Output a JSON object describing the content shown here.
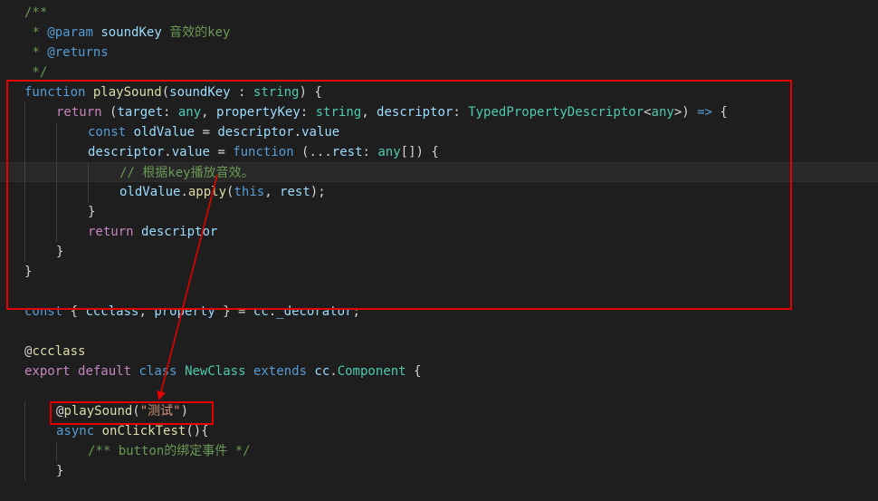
{
  "colors": {
    "background": "#1e1e1e",
    "comment": "#6a9955",
    "keyword": "#569cd6",
    "control": "#c586c0",
    "function": "#dcdcaa",
    "variable": "#9cdcfe",
    "type": "#4ec9b0",
    "string": "#ce9178",
    "plain": "#d4d4d4",
    "annotation": "#e50000"
  },
  "code_lines": [
    {
      "indent": 1,
      "tokens": [
        {
          "t": "/**",
          "c": "comment"
        }
      ]
    },
    {
      "indent": 1,
      "tokens": [
        {
          "t": " * ",
          "c": "comment"
        },
        {
          "t": "@param",
          "c": "keyword"
        },
        {
          "t": " ",
          "c": "comment"
        },
        {
          "t": "soundKey",
          "c": "variable"
        },
        {
          "t": " 音效的key",
          "c": "comment"
        }
      ]
    },
    {
      "indent": 1,
      "tokens": [
        {
          "t": " * ",
          "c": "comment"
        },
        {
          "t": "@returns",
          "c": "keyword"
        }
      ]
    },
    {
      "indent": 1,
      "tokens": [
        {
          "t": " */",
          "c": "comment"
        }
      ]
    },
    {
      "indent": 1,
      "tokens": [
        {
          "t": "function",
          "c": "keyword"
        },
        {
          "t": " ",
          "c": "plain"
        },
        {
          "t": "playSound",
          "c": "function"
        },
        {
          "t": "(",
          "c": "plain"
        },
        {
          "t": "soundKey",
          "c": "variable"
        },
        {
          "t": " : ",
          "c": "plain"
        },
        {
          "t": "string",
          "c": "type"
        },
        {
          "t": ") {",
          "c": "plain"
        }
      ]
    },
    {
      "indent": 2,
      "tokens": [
        {
          "t": "return",
          "c": "control"
        },
        {
          "t": " (",
          "c": "plain"
        },
        {
          "t": "target",
          "c": "variable"
        },
        {
          "t": ": ",
          "c": "plain"
        },
        {
          "t": "any",
          "c": "type"
        },
        {
          "t": ", ",
          "c": "plain"
        },
        {
          "t": "propertyKey",
          "c": "variable"
        },
        {
          "t": ": ",
          "c": "plain"
        },
        {
          "t": "string",
          "c": "type"
        },
        {
          "t": ", ",
          "c": "plain"
        },
        {
          "t": "descriptor",
          "c": "variable"
        },
        {
          "t": ": ",
          "c": "plain"
        },
        {
          "t": "TypedPropertyDescriptor",
          "c": "type"
        },
        {
          "t": "<",
          "c": "plain"
        },
        {
          "t": "any",
          "c": "type"
        },
        {
          "t": ">) ",
          "c": "plain"
        },
        {
          "t": "=>",
          "c": "keyword"
        },
        {
          "t": " {",
          "c": "plain"
        }
      ]
    },
    {
      "indent": 3,
      "tokens": [
        {
          "t": "const",
          "c": "keyword"
        },
        {
          "t": " ",
          "c": "plain"
        },
        {
          "t": "oldValue",
          "c": "variable"
        },
        {
          "t": " = ",
          "c": "plain"
        },
        {
          "t": "descriptor",
          "c": "variable"
        },
        {
          "t": ".",
          "c": "plain"
        },
        {
          "t": "value",
          "c": "variable"
        }
      ]
    },
    {
      "indent": 3,
      "tokens": [
        {
          "t": "descriptor",
          "c": "variable"
        },
        {
          "t": ".",
          "c": "plain"
        },
        {
          "t": "value",
          "c": "variable"
        },
        {
          "t": " = ",
          "c": "plain"
        },
        {
          "t": "function",
          "c": "keyword"
        },
        {
          "t": " (...",
          "c": "plain"
        },
        {
          "t": "rest",
          "c": "variable"
        },
        {
          "t": ": ",
          "c": "plain"
        },
        {
          "t": "any",
          "c": "type"
        },
        {
          "t": "[]) {",
          "c": "plain"
        }
      ]
    },
    {
      "indent": 4,
      "current": true,
      "tokens": [
        {
          "t": "// 根据key播放音效。",
          "c": "comment"
        }
      ]
    },
    {
      "indent": 4,
      "tokens": [
        {
          "t": "oldValue",
          "c": "variable"
        },
        {
          "t": ".",
          "c": "plain"
        },
        {
          "t": "apply",
          "c": "function"
        },
        {
          "t": "(",
          "c": "plain"
        },
        {
          "t": "this",
          "c": "keyword"
        },
        {
          "t": ", ",
          "c": "plain"
        },
        {
          "t": "rest",
          "c": "variable"
        },
        {
          "t": ");",
          "c": "plain"
        }
      ]
    },
    {
      "indent": 3,
      "tokens": [
        {
          "t": "}",
          "c": "plain"
        }
      ]
    },
    {
      "indent": 3,
      "tokens": [
        {
          "t": "return",
          "c": "control"
        },
        {
          "t": " ",
          "c": "plain"
        },
        {
          "t": "descriptor",
          "c": "variable"
        }
      ]
    },
    {
      "indent": 2,
      "tokens": [
        {
          "t": "}",
          "c": "plain"
        }
      ]
    },
    {
      "indent": 1,
      "tokens": [
        {
          "t": "}",
          "c": "plain"
        }
      ]
    },
    {
      "indent": 1,
      "tokens": []
    },
    {
      "indent": 1,
      "tokens": [
        {
          "t": "const",
          "c": "keyword"
        },
        {
          "t": " { ",
          "c": "plain"
        },
        {
          "t": "ccclass",
          "c": "variable"
        },
        {
          "t": ", ",
          "c": "plain"
        },
        {
          "t": "property",
          "c": "variable"
        },
        {
          "t": " } = ",
          "c": "plain"
        },
        {
          "t": "cc",
          "c": "variable"
        },
        {
          "t": ".",
          "c": "plain"
        },
        {
          "t": "_decorator",
          "c": "variable"
        },
        {
          "t": ";",
          "c": "plain"
        }
      ]
    },
    {
      "indent": 1,
      "tokens": []
    },
    {
      "indent": 1,
      "tokens": [
        {
          "t": "@",
          "c": "plain"
        },
        {
          "t": "ccclass",
          "c": "function"
        }
      ]
    },
    {
      "indent": 1,
      "tokens": [
        {
          "t": "export",
          "c": "control"
        },
        {
          "t": " ",
          "c": "plain"
        },
        {
          "t": "default",
          "c": "control"
        },
        {
          "t": " ",
          "c": "plain"
        },
        {
          "t": "class",
          "c": "keyword"
        },
        {
          "t": " ",
          "c": "plain"
        },
        {
          "t": "NewClass",
          "c": "type"
        },
        {
          "t": " ",
          "c": "plain"
        },
        {
          "t": "extends",
          "c": "keyword"
        },
        {
          "t": " ",
          "c": "plain"
        },
        {
          "t": "cc",
          "c": "variable"
        },
        {
          "t": ".",
          "c": "plain"
        },
        {
          "t": "Component",
          "c": "type"
        },
        {
          "t": " {",
          "c": "plain"
        }
      ]
    },
    {
      "indent": 1,
      "tokens": []
    },
    {
      "indent": 2,
      "tokens": [
        {
          "t": "@",
          "c": "plain"
        },
        {
          "t": "playSound",
          "c": "function"
        },
        {
          "t": "(",
          "c": "plain"
        },
        {
          "t": "\"测试\"",
          "c": "string"
        },
        {
          "t": ")",
          "c": "plain"
        }
      ]
    },
    {
      "indent": 2,
      "tokens": [
        {
          "t": "async",
          "c": "keyword"
        },
        {
          "t": " ",
          "c": "plain"
        },
        {
          "t": "onClickTest",
          "c": "function"
        },
        {
          "t": "(){",
          "c": "plain"
        }
      ]
    },
    {
      "indent": 3,
      "tokens": [
        {
          "t": "/** button的绑定事件 */",
          "c": "comment"
        }
      ]
    },
    {
      "indent": 2,
      "tokens": [
        {
          "t": "}",
          "c": "plain"
        }
      ]
    },
    {
      "indent": 1,
      "tokens": []
    }
  ]
}
